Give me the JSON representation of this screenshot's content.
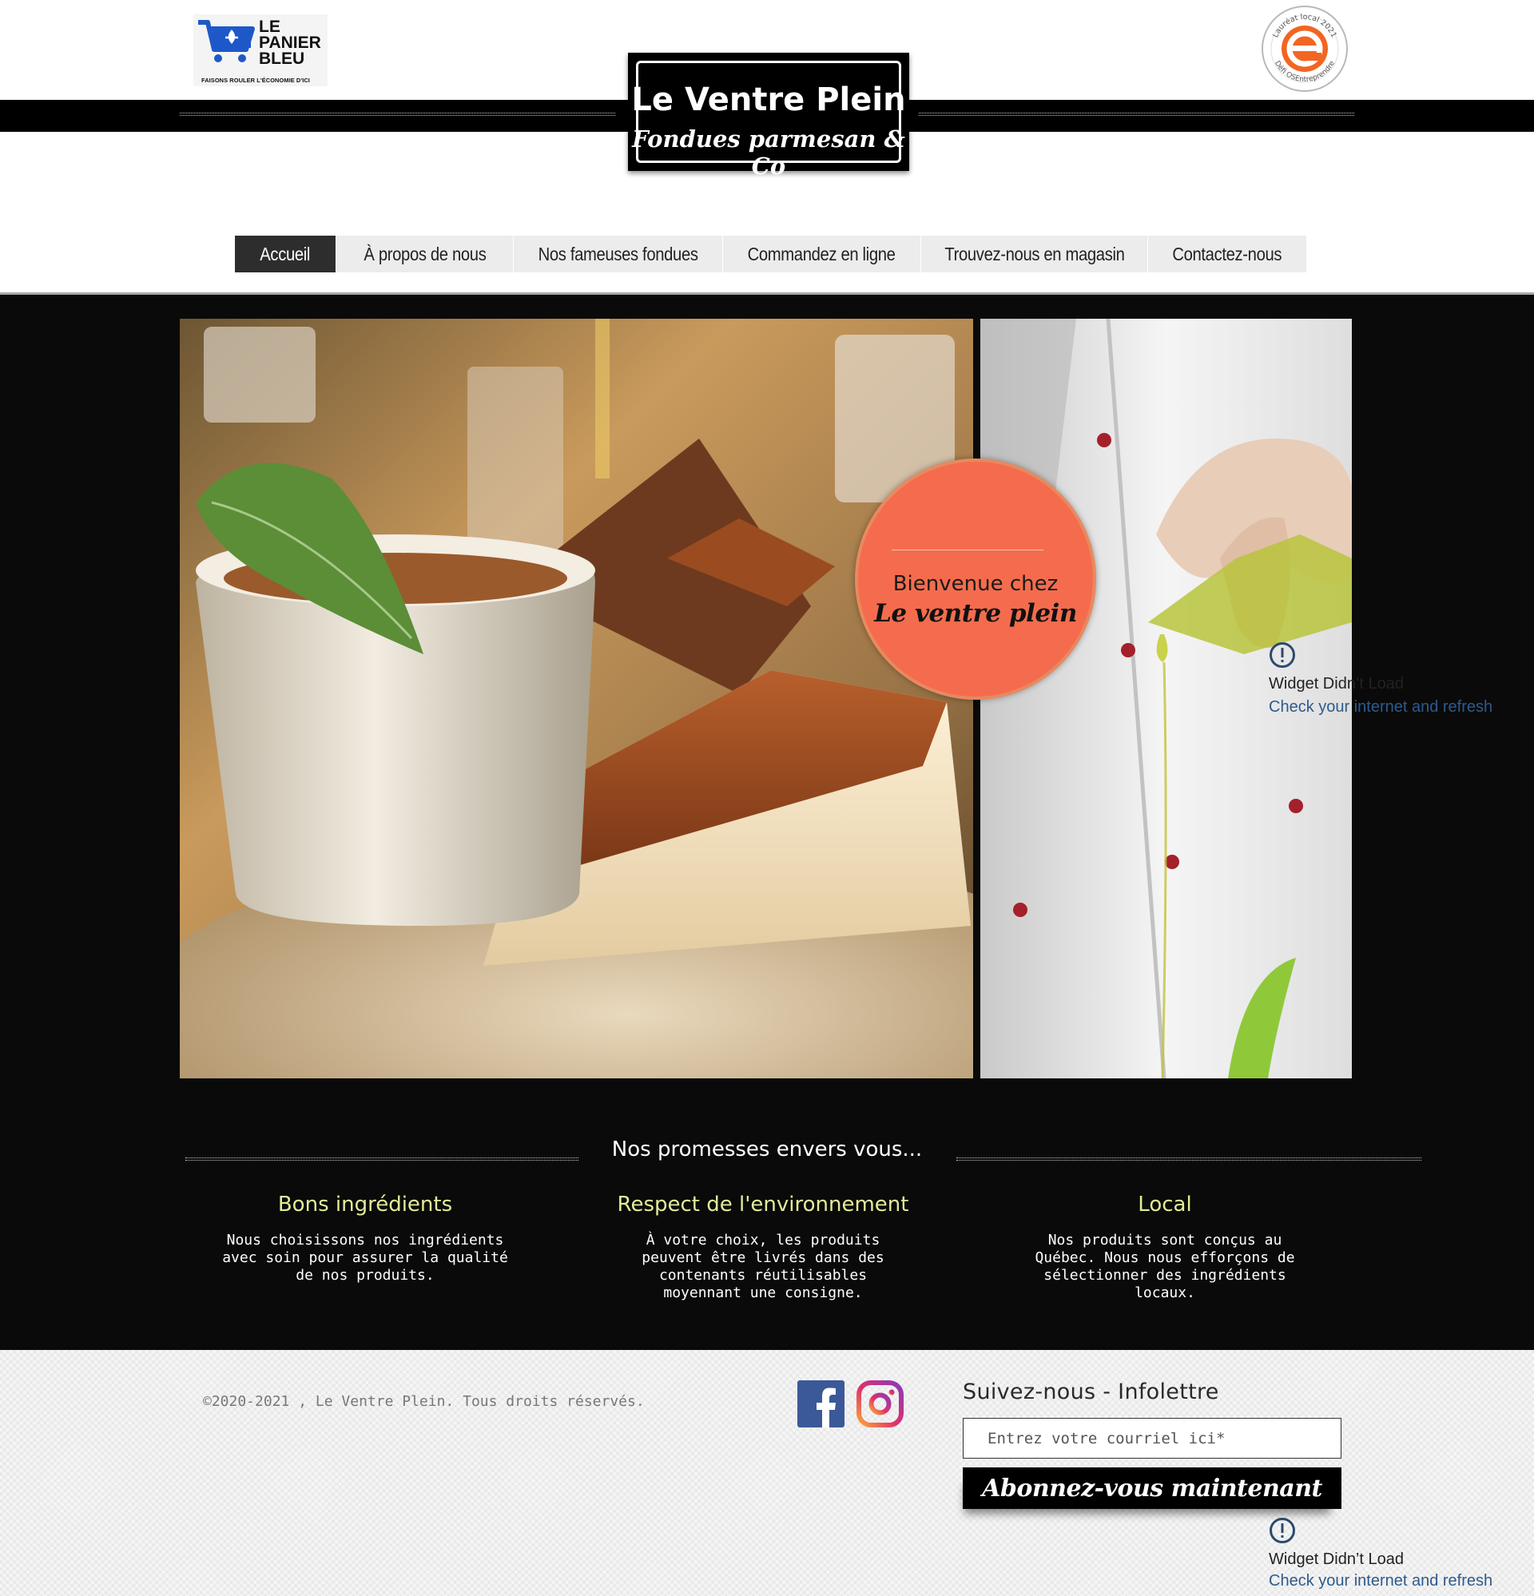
{
  "header": {
    "panier_logo": {
      "line1": "LE",
      "line2": "PANIER",
      "line3": "BLEU",
      "tagline": "FAISONS ROULER L'ÉCONOMIE D'ICI"
    },
    "logo": {
      "title": "Le Ventre Plein",
      "subtitle": "Fondues parmesan & Co"
    },
    "badge": {
      "text_top": "Lauréat local 2021",
      "text_bottom": "Défi OSEntreprendre"
    }
  },
  "nav": {
    "items": [
      {
        "label": "Accueil",
        "active": true
      },
      {
        "label": "À propos de nous",
        "active": false
      },
      {
        "label": "Nos fameuses fondues",
        "active": false
      },
      {
        "label": "Commandez en ligne",
        "active": false
      },
      {
        "label": "Trouvez-nous en magasin",
        "active": false
      },
      {
        "label": "Contactez-nous",
        "active": false
      }
    ]
  },
  "hero": {
    "welcome_text": "Bienvenue chez",
    "welcome_name": "Le ventre plein",
    "widget_error": {
      "title": "Widget Didn’t Load",
      "link": "Check your internet and refresh"
    }
  },
  "promises": {
    "title": "Nos promesses envers vous...",
    "items": [
      {
        "title": "Bons ingrédients",
        "text": "Nous choisissons nos ingrédients avec soin pour assurer la qualité de nos produits."
      },
      {
        "title": "Respect de l'environnement",
        "text": "À votre choix, les produits peuvent être livrés dans des contenants réutilisables moyennant une consigne."
      },
      {
        "title": "Local",
        "text": "Nos produits sont conçus au Québec. Nous nous efforçons de sélectionner des ingrédients locaux."
      }
    ]
  },
  "footer": {
    "copyright": "©2020-2021 , Le Ventre Plein. Tous droits réservés.",
    "social": [
      "facebook-icon",
      "instagram-icon"
    ],
    "newsletter_title": "Suivez-nous - Infolettre",
    "email_placeholder": "Entrez votre courriel ici*",
    "subscribe_label": "Abonnez-vous maintenant",
    "widget_error": {
      "title": "Widget Didn’t Load",
      "link": "Check your internet and refresh"
    }
  },
  "colors": {
    "hero_bg": "#0a0a0a",
    "accent_circle": "#f46c4d",
    "promise_title": "#e3eb9a",
    "nav_active": "#2d2d2d",
    "panier_blue": "#1e58c8"
  }
}
